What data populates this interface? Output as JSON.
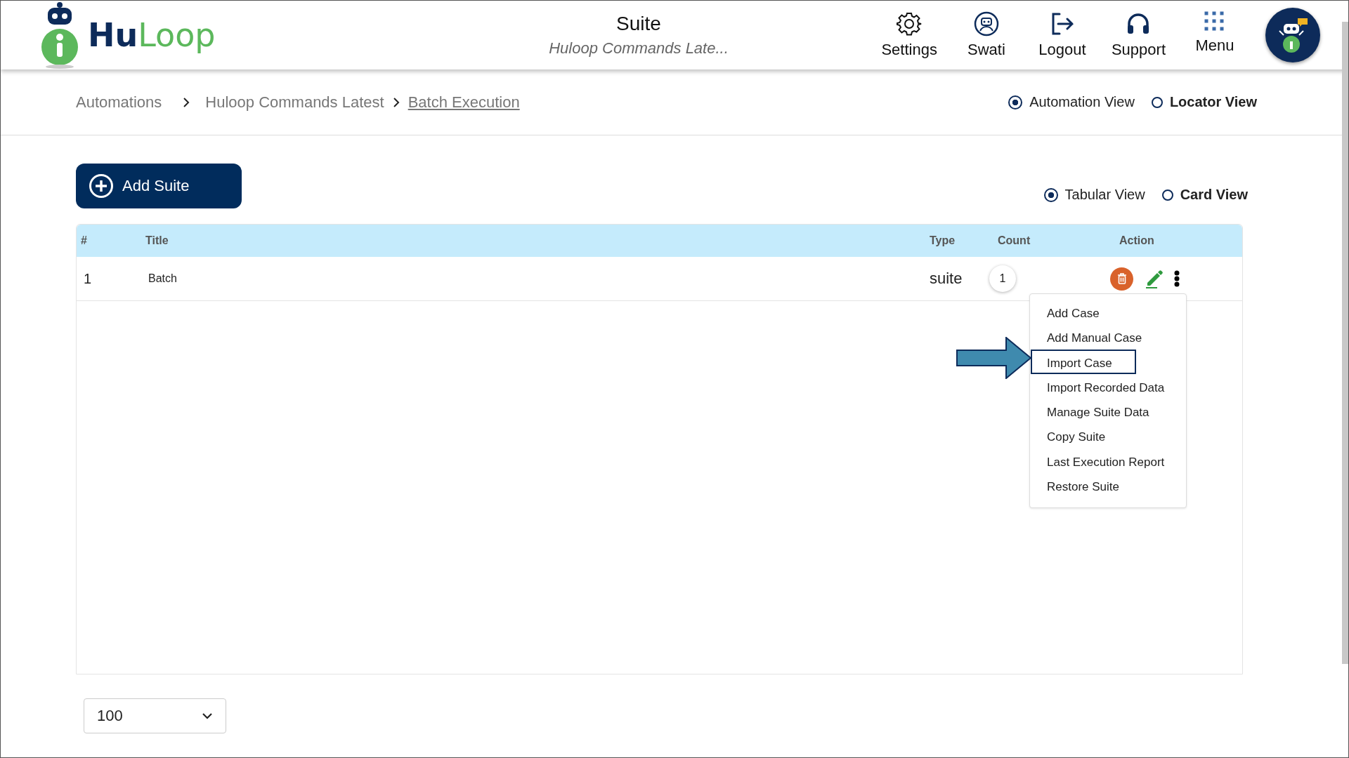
{
  "header": {
    "logo_parts": [
      "Hu",
      "Loop"
    ],
    "title": "Suite",
    "subtitle": "Huloop Commands Late...",
    "nav": [
      {
        "kind": "settings",
        "label": "Settings"
      },
      {
        "kind": "user",
        "label": "Swati"
      },
      {
        "kind": "logout",
        "label": "Logout"
      },
      {
        "kind": "support",
        "label": "Support"
      },
      {
        "kind": "menu",
        "label": "Menu"
      }
    ]
  },
  "breadcrumb": [
    {
      "label": "Automations",
      "current": false
    },
    {
      "label": "Huloop Commands Latest",
      "current": false
    },
    {
      "label": "Batch Execution",
      "current": true
    }
  ],
  "view_mode": [
    {
      "label": "Automation View",
      "selected": true
    },
    {
      "label": "Locator View",
      "selected": false
    }
  ],
  "add_button": "Add Suite",
  "display_mode": [
    {
      "label": "Tabular View",
      "selected": true
    },
    {
      "label": "Card View",
      "selected": false
    }
  ],
  "table": {
    "columns": [
      "#",
      "Title",
      "Type",
      "Count",
      "Action"
    ],
    "rows": [
      {
        "index": "1",
        "title": "Batch",
        "type": "suite",
        "count": "1"
      }
    ]
  },
  "action_menu": {
    "items": [
      {
        "label": "Add Case",
        "highlighted": false
      },
      {
        "label": "Add Manual Case",
        "highlighted": false
      },
      {
        "label": "Import Case",
        "highlighted": true
      },
      {
        "label": "Import Recorded Data",
        "highlighted": false
      },
      {
        "label": "Manage Suite Data",
        "highlighted": false
      },
      {
        "label": "Copy Suite",
        "highlighted": false
      },
      {
        "label": "Last Execution Report",
        "highlighted": false
      },
      {
        "label": "Restore Suite",
        "highlighted": false
      }
    ]
  },
  "page_size": {
    "value": "100"
  }
}
